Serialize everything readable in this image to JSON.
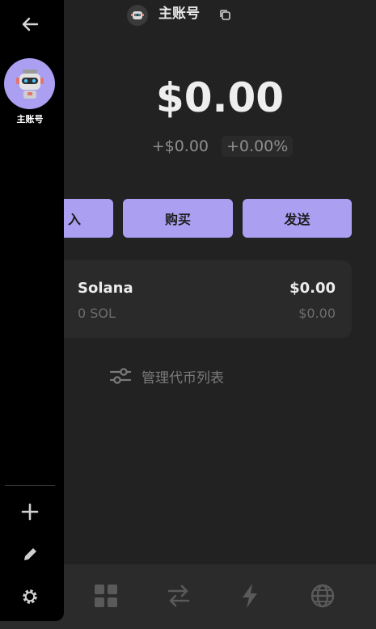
{
  "header": {
    "account_name": "主账号",
    "avatar_icon": "robot-avatar-icon",
    "copy_icon": "copy-icon"
  },
  "portfolio": {
    "balance": "$0.00",
    "change_value": "+$0.00",
    "change_percent": "+0.00%"
  },
  "actions": {
    "receive_label": "入",
    "buy_label": "购买",
    "send_label": "发送"
  },
  "tokens": [
    {
      "name": "Solana",
      "amount": "0 SOL",
      "value": "$0.00",
      "value_sub": "$0.00"
    }
  ],
  "manage_label": "管理代币列表",
  "bottom_nav": [
    "grid-icon",
    "swap-icon",
    "lightning-icon",
    "globe-icon"
  ],
  "sidebar": {
    "account_label": "主账号",
    "icons": [
      "back-arrow-icon",
      "plus-icon",
      "pencil-icon",
      "gear-icon"
    ]
  },
  "colors": {
    "accent": "#ab9ff2",
    "background": "#222222",
    "sidebar": "#000000",
    "card": "#2a2a2a"
  }
}
